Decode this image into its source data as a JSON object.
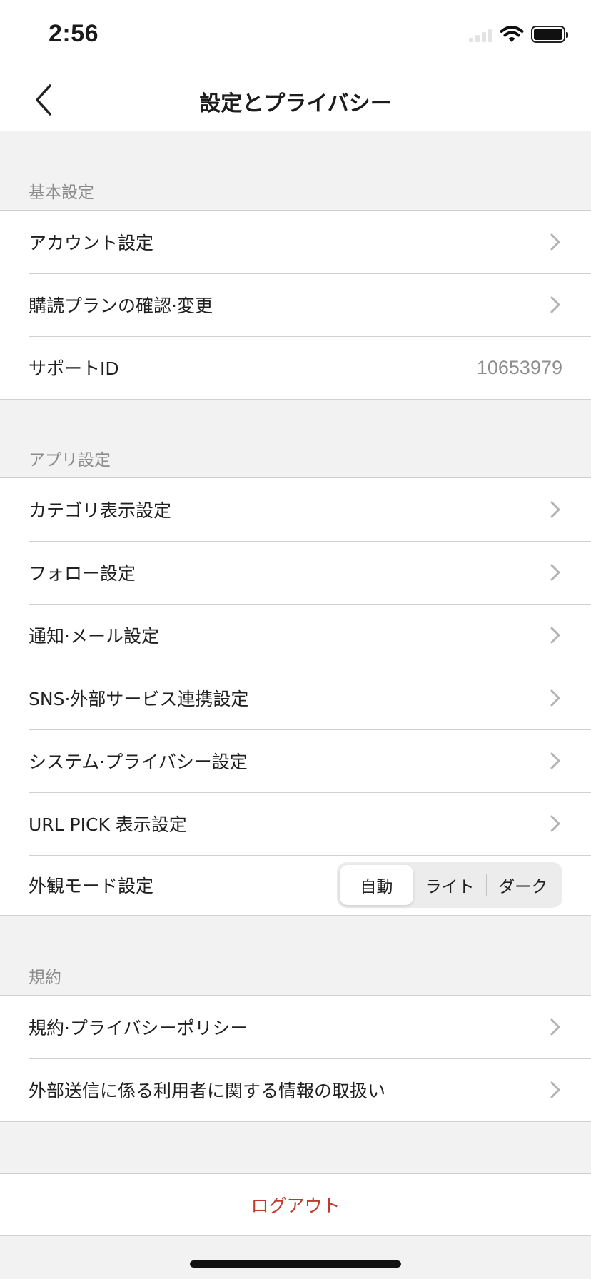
{
  "status_bar": {
    "time": "2:56"
  },
  "nav": {
    "title": "設定とプライバシー"
  },
  "sections": {
    "basic": {
      "header": "基本設定",
      "account": "アカウント設定",
      "plan": "購読プランの確認·変更",
      "support_label": "サポートID",
      "support_value": "10653979"
    },
    "app": {
      "header": "アプリ設定",
      "category": "カテゴリ表示設定",
      "follow": "フォロー設定",
      "notify": "通知·メール設定",
      "sns": "SNS·外部サービス連携設定",
      "system": "システム·プライバシー設定",
      "urlpick": "URL PICK 表示設定",
      "appearance": {
        "label": "外観モード設定",
        "options": [
          "自動",
          "ライト",
          "ダーク"
        ],
        "selected": "自動"
      }
    },
    "terms": {
      "header": "規約",
      "privacy": "規約·プライバシーポリシー",
      "external": "外部送信に係る利用者に関する情報の取扱い"
    }
  },
  "logout": {
    "label": "ログアウト"
  },
  "icons": {
    "back": "chevron-left-icon",
    "disclosure": "chevron-right-icon",
    "wifi": "wifi-icon",
    "battery": "battery-icon",
    "signal": "signal-icon"
  },
  "colors": {
    "background": "#f2f2f2",
    "surface": "#ffffff",
    "logout": "#c0392b",
    "secondary_text": "#8c8c8c"
  }
}
